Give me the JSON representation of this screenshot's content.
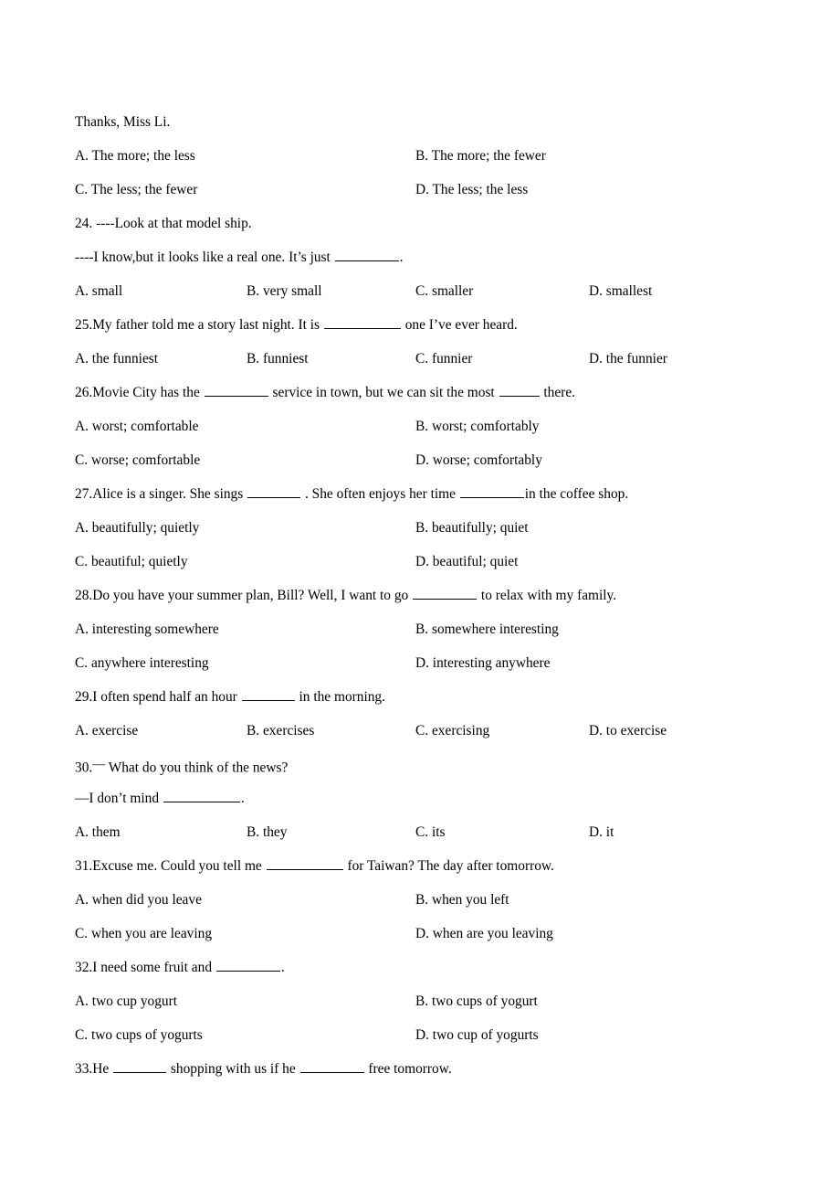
{
  "document": {
    "type": "english-grammar-multiple-choice-worksheet",
    "lines": [
      {
        "id": "closing-note",
        "kind": "text",
        "text": "Thanks, Miss Li."
      },
      {
        "id": "q23-options-ab",
        "kind": "options2",
        "options": [
          "A. The more; the less",
          "B. The more; the fewer"
        ]
      },
      {
        "id": "q23-options-cd",
        "kind": "options2",
        "options": [
          "C. The less; the fewer",
          "D. The less; the less"
        ]
      },
      {
        "id": "q24-stem-a",
        "kind": "text",
        "text": "24. ----Look at that model ship."
      },
      {
        "id": "q24-stem-b",
        "kind": "stem",
        "parts": [
          "----I know,but it looks like a real one. It’s just ",
          "__blank-md__",
          "."
        ]
      },
      {
        "id": "q24-options",
        "kind": "options4",
        "options": [
          "A. small",
          "B. very small",
          "C. smaller",
          "D. smallest"
        ]
      },
      {
        "id": "q25-stem",
        "kind": "stem",
        "parts": [
          "25.My father told me a story last night. It is ",
          "__blank-lg__",
          " one I’ve ever heard."
        ]
      },
      {
        "id": "q25-options",
        "kind": "options4",
        "options": [
          "A. the funniest",
          "B. funniest",
          "C. funnier",
          "D. the funnier"
        ]
      },
      {
        "id": "q26-stem",
        "kind": "stem",
        "parts": [
          "26.Movie City has the ",
          "__blank-md__",
          " service in town, but we can sit the most ",
          "__blank-xs__",
          " there."
        ]
      },
      {
        "id": "q26-options-ab",
        "kind": "options2",
        "options": [
          "A. worst; comfortable",
          "B. worst; comfortably"
        ]
      },
      {
        "id": "q26-options-cd",
        "kind": "options2",
        "options": [
          "C. worse; comfortable",
          "D. worse; comfortably"
        ]
      },
      {
        "id": "q27-stem",
        "kind": "stem",
        "parts": [
          "27.Alice is a singer. She sings ",
          "__blank-sm__",
          " . She often enjoys her time ",
          "__blank-md__",
          "in the coffee shop."
        ]
      },
      {
        "id": "q27-options-ab",
        "kind": "options2",
        "options": [
          "A. beautifully; quietly",
          "B. beautifully; quiet"
        ]
      },
      {
        "id": "q27-options-cd",
        "kind": "options2",
        "options": [
          "C. beautiful; quietly",
          "D. beautiful; quiet"
        ]
      },
      {
        "id": "q28-stem",
        "kind": "stem",
        "parts": [
          "28.Do you have your summer plan, Bill? Well, I want to go ",
          "__blank-md__",
          " to relax with my family."
        ]
      },
      {
        "id": "q28-options-ab",
        "kind": "options2",
        "options": [
          "A. interesting somewhere",
          "B. somewhere interesting"
        ]
      },
      {
        "id": "q28-options-cd",
        "kind": "options2",
        "options": [
          "C. anywhere interesting",
          "D. interesting anywhere"
        ]
      },
      {
        "id": "q29-stem",
        "kind": "stem",
        "parts": [
          "29.I often spend half an hour ",
          "__blank-sm__",
          " in the morning."
        ]
      },
      {
        "id": "q29-options",
        "kind": "options4",
        "options": [
          "A. exercise",
          "B. exercises",
          "C. exercising",
          "D. to exercise"
        ]
      },
      {
        "id": "q30-stem-a",
        "kind": "stem",
        "parts": [
          "30.",
          "__dash-sup__",
          " What do you think of the news?"
        ]
      },
      {
        "id": "q30-stem-b",
        "kind": "stem",
        "parts": [
          "—I don’t mind ",
          "__blank-lg__",
          "."
        ]
      },
      {
        "id": "q30-options",
        "kind": "options4",
        "options": [
          "A. them",
          "B. they",
          "C. its",
          "D. it"
        ]
      },
      {
        "id": "q31-stem",
        "kind": "stem",
        "parts": [
          "31.Excuse me. Could you tell me ",
          "__blank-lg__",
          " for Taiwan?    The day after tomorrow."
        ]
      },
      {
        "id": "q31-options-ab",
        "kind": "options2",
        "options": [
          "A. when did you leave",
          "B. when you left"
        ]
      },
      {
        "id": "q31-options-cd",
        "kind": "options2",
        "options": [
          "C. when you are leaving",
          "D. when are you leaving"
        ]
      },
      {
        "id": "q32-stem",
        "kind": "stem",
        "parts": [
          "32.I need some fruit and ",
          "__blank-md__",
          "."
        ]
      },
      {
        "id": "q32-options-ab",
        "kind": "options2",
        "options": [
          "A. two cup yogurt",
          "B. two cups of yogurt"
        ]
      },
      {
        "id": "q32-options-cd",
        "kind": "options2",
        "options": [
          "C. two cups of yogurts",
          "D. two cup of yogurts"
        ]
      },
      {
        "id": "q33-stem",
        "kind": "stem",
        "parts": [
          "33.He ",
          "__blank-sm__",
          " shopping with us if he ",
          "__blank-md__",
          " free tomorrow."
        ]
      }
    ]
  }
}
